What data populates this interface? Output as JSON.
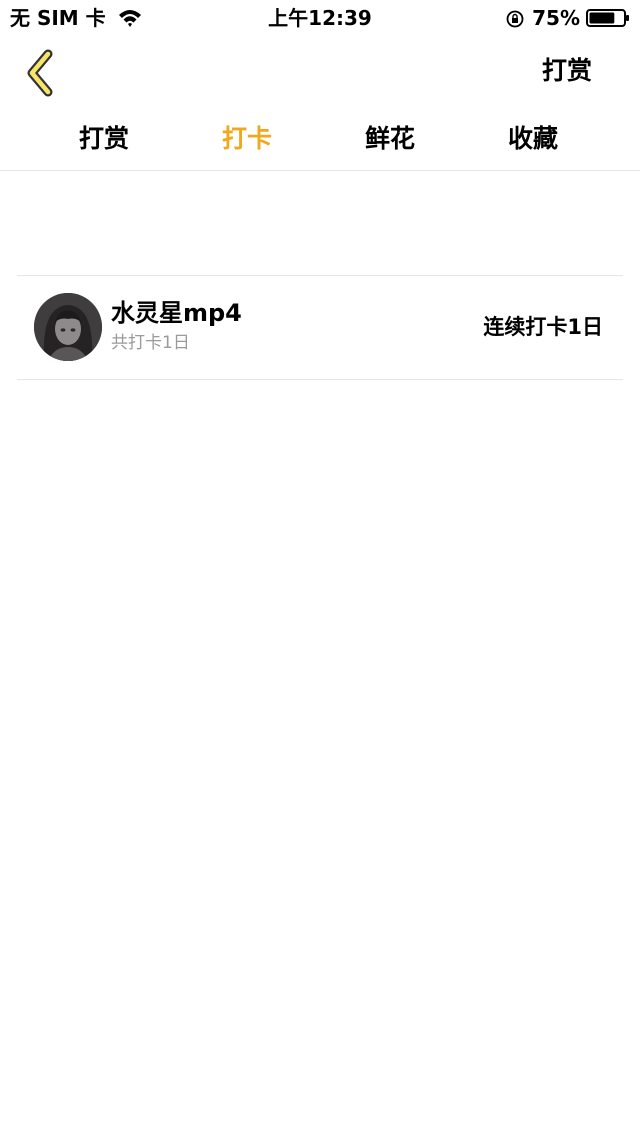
{
  "status_bar": {
    "carrier": "无 SIM 卡",
    "time": "上午12:39",
    "battery": "75%",
    "battery_level": 0.75,
    "icons": [
      "wifi-icon",
      "orientation-lock-icon",
      "battery-icon"
    ]
  },
  "nav": {
    "back_icon": "chevron-left-icon",
    "right_action": "打赏",
    "accent_color": "#f0a81c"
  },
  "tabs": [
    {
      "label": "打赏",
      "active": false
    },
    {
      "label": "打卡",
      "active": true
    },
    {
      "label": "鲜花",
      "active": false
    },
    {
      "label": "收藏",
      "active": false
    }
  ],
  "list": [
    {
      "name": "水灵星mp4",
      "subtitle": "共打卡1日",
      "streak": "连续打卡1日",
      "avatar_icon": "anime-girl-avatar"
    }
  ]
}
